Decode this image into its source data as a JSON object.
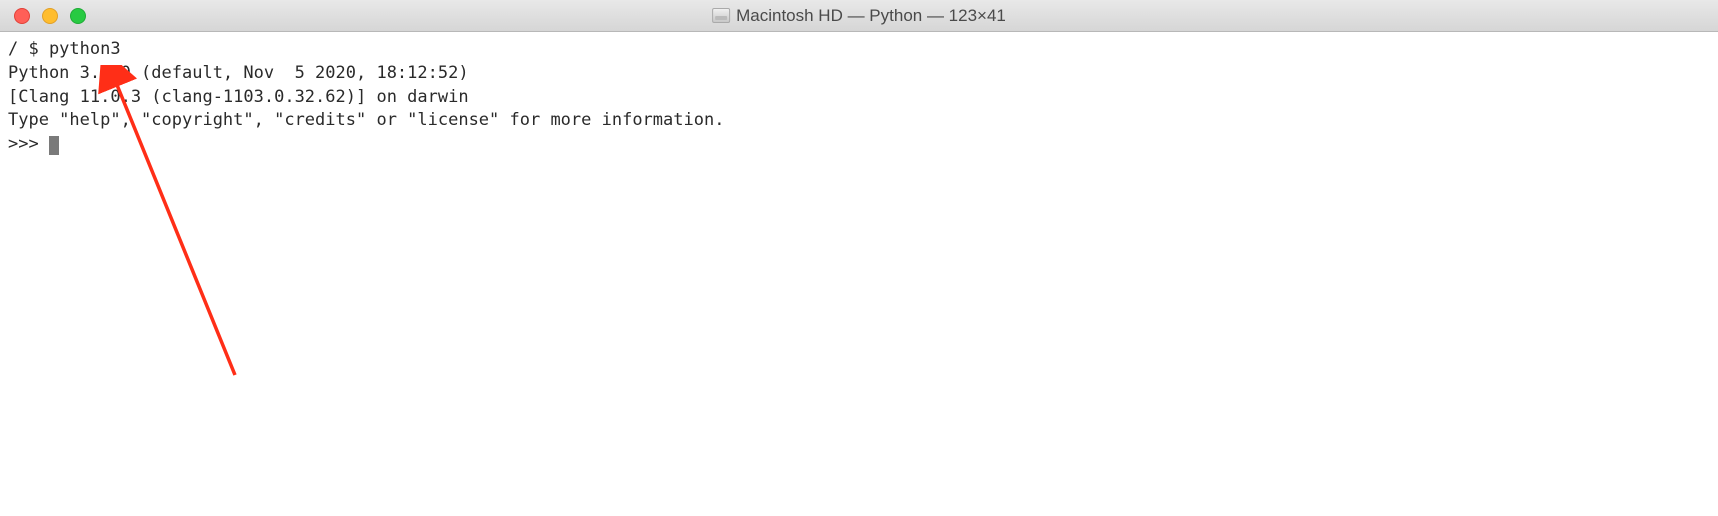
{
  "titlebar": {
    "title": "Macintosh HD — Python — 123×41"
  },
  "terminal": {
    "line1": "/ $ python3",
    "line2": "Python 3.9.0 (default, Nov  5 2020, 18:12:52) ",
    "line3": "[Clang 11.0.3 (clang-1103.0.32.62)] on darwin",
    "line4": "Type \"help\", \"copyright\", \"credits\" or \"license\" for more information.",
    "prompt": ">>> "
  }
}
